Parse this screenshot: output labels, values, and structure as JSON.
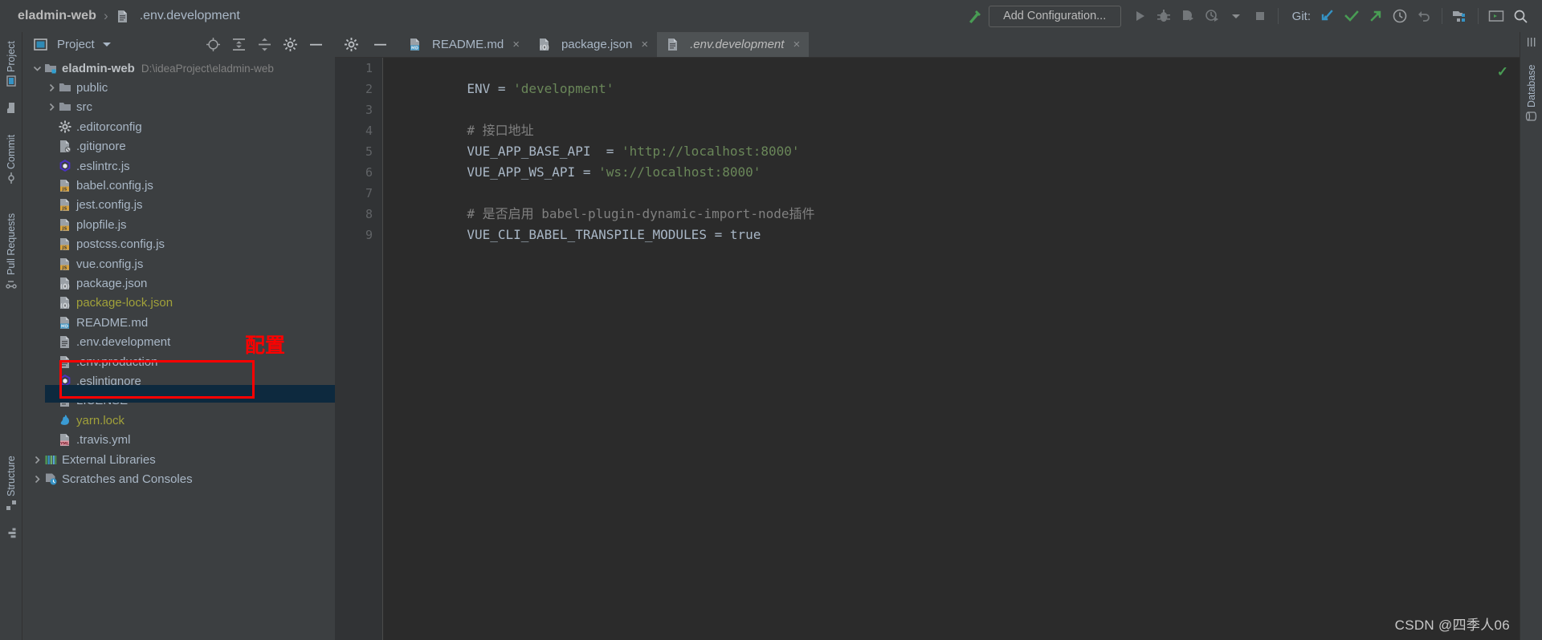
{
  "window": {
    "breadcrumb_project": "eladmin-web",
    "breadcrumb_separator": "›",
    "breadcrumb_file": ".env.development"
  },
  "toolbar": {
    "add_configuration": "Add Configuration...",
    "git_label": "Git:",
    "icons": [
      "hammer-build-icon",
      "run-icon",
      "debug-icon",
      "run-coverage-icon",
      "profile-icon",
      "dropdown-arrow-icon",
      "stop-icon",
      "git-update-icon",
      "git-commit-icon",
      "git-push-icon",
      "history-icon",
      "rollback-icon",
      "project-structure-icon",
      "terminal-icon",
      "search-everywhere-icon"
    ],
    "accent_green": "#499c54",
    "accent_blue": "#3592c4"
  },
  "left_strip": {
    "items": [
      {
        "label": "Project",
        "icon": "project-icon"
      },
      {
        "label": "Commit",
        "icon": "commit-icon"
      },
      {
        "label": "Pull Requests",
        "icon": "pull-requests-icon"
      },
      {
        "label": "Structure",
        "icon": "structure-icon"
      }
    ]
  },
  "right_strip": {
    "items": [
      {
        "label": "Database",
        "icon": "database-icon"
      }
    ]
  },
  "project_panel": {
    "title": "Project",
    "header_icons": [
      "locate-target-icon",
      "expand-all-icon",
      "collapse-all-icon",
      "settings-gear-icon",
      "hide-panel-icon"
    ],
    "tree": [
      {
        "label": "eladmin-web",
        "path": "D:\\ideaProject\\eladmin-web",
        "icon": "module-folder-icon",
        "arrow": "expanded",
        "depth": 0,
        "bold": true
      },
      {
        "label": "public",
        "icon": "folder-icon",
        "arrow": "collapsed",
        "depth": 1
      },
      {
        "label": "src",
        "icon": "folder-icon",
        "arrow": "collapsed",
        "depth": 1
      },
      {
        "label": ".editorconfig",
        "icon": "gear-file-icon",
        "depth": 1
      },
      {
        "label": ".gitignore",
        "icon": "gitignore-file-icon",
        "depth": 1
      },
      {
        "label": ".eslintrc.js",
        "icon": "eslint-file-icon",
        "depth": 1
      },
      {
        "label": "babel.config.js",
        "icon": "js-file-icon",
        "depth": 1
      },
      {
        "label": "jest.config.js",
        "icon": "js-file-icon",
        "depth": 1
      },
      {
        "label": "plopfile.js",
        "icon": "js-file-icon",
        "depth": 1
      },
      {
        "label": "postcss.config.js",
        "icon": "js-file-icon",
        "depth": 1
      },
      {
        "label": "vue.config.js",
        "icon": "js-file-icon",
        "depth": 1
      },
      {
        "label": "package.json",
        "icon": "json-file-icon",
        "depth": 1
      },
      {
        "label": "package-lock.json",
        "icon": "json-file-icon",
        "depth": 1,
        "color": "olive"
      },
      {
        "label": "README.md",
        "icon": "md-file-icon",
        "depth": 1
      },
      {
        "label": ".env.development",
        "icon": "text-file-icon",
        "depth": 1,
        "selected": true
      },
      {
        "label": ".env.production",
        "icon": "text-file-icon",
        "depth": 1
      },
      {
        "label": ".eslintignore",
        "icon": "eslint-file-icon",
        "depth": 1
      },
      {
        "label": "LICENSE",
        "icon": "text-file-icon",
        "depth": 1
      },
      {
        "label": "yarn.lock",
        "icon": "yarn-file-icon",
        "depth": 1,
        "color": "olive"
      },
      {
        "label": ".travis.yml",
        "icon": "yml-file-icon",
        "depth": 1
      },
      {
        "label": "External Libraries",
        "icon": "libraries-icon",
        "arrow": "collapsed",
        "depth": 0
      },
      {
        "label": "Scratches and Consoles",
        "icon": "scratches-icon",
        "arrow": "collapsed",
        "depth": 0
      }
    ]
  },
  "annotation": {
    "text": "配置",
    "color": "#fe0000"
  },
  "editor": {
    "tabs": [
      {
        "label": "README.md",
        "icon": "md-file-icon",
        "active": false,
        "close": "×"
      },
      {
        "label": "package.json",
        "icon": "json-file-icon",
        "active": false,
        "close": "×"
      },
      {
        "label": ".env.development",
        "icon": "text-file-icon",
        "active": true,
        "close": "×"
      }
    ],
    "tab_lead_icons": [
      "gear-icon",
      "hide-editor-icon"
    ],
    "line_numbers": [
      "1",
      "2",
      "3",
      "4",
      "5",
      "6",
      "7",
      "8",
      "9"
    ],
    "lines": [
      {
        "n": "1",
        "segments": [
          {
            "t": "ENV = ",
            "c": "key"
          },
          {
            "t": "'development'",
            "c": "str"
          }
        ]
      },
      {
        "n": "2",
        "segments": []
      },
      {
        "n": "3",
        "segments": [
          {
            "t": "# 接口地址",
            "c": "cmt"
          }
        ]
      },
      {
        "n": "4",
        "segments": [
          {
            "t": "VUE_APP_BASE_API  = ",
            "c": "key"
          },
          {
            "t": "'http://localhost:8000'",
            "c": "str"
          }
        ]
      },
      {
        "n": "5",
        "segments": [
          {
            "t": "VUE_APP_WS_API = ",
            "c": "key"
          },
          {
            "t": "'ws://localhost:8000'",
            "c": "str"
          }
        ]
      },
      {
        "n": "6",
        "segments": []
      },
      {
        "n": "7",
        "segments": [
          {
            "t": "# 是否启用 babel-plugin-dynamic-import-node插件",
            "c": "cmt"
          }
        ]
      },
      {
        "n": "8",
        "segments": [
          {
            "t": "VUE_CLI_BABEL_TRANSPILE_MODULES = ",
            "c": "key"
          },
          {
            "t": "true",
            "c": "val"
          }
        ]
      },
      {
        "n": "9",
        "segments": []
      }
    ],
    "inspection_status": "✓"
  },
  "watermark": "CSDN @四季人06"
}
